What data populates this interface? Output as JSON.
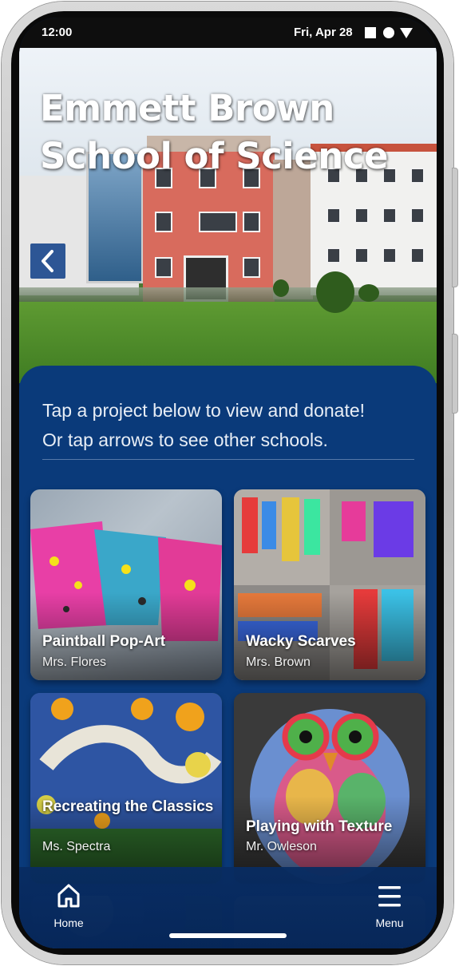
{
  "status_bar": {
    "time": "12:00",
    "date": "Fri, Apr 28",
    "icons": [
      "square-icon",
      "circle-icon",
      "triangle-icon"
    ]
  },
  "hero": {
    "title_line1": "Emmett Brown",
    "title_line2": "School of Science",
    "prev_icon": "chevron-left-icon",
    "carousel": {
      "count": 2,
      "active_index": 2
    }
  },
  "intro": {
    "line1": "Tap a project below to view and donate!",
    "line2": "Or tap arrows to see other schools."
  },
  "projects": [
    {
      "title": "Paintball Pop-Art",
      "teacher": "Mrs. Flores"
    },
    {
      "title": "Wacky Scarves",
      "teacher": "Mrs. Brown"
    },
    {
      "title": "Recreating the Classics",
      "teacher": "Ms. Spectra"
    },
    {
      "title": "Playing with Texture",
      "teacher": "Mr. Owleson"
    }
  ],
  "nav": {
    "home_label": "Home",
    "menu_label": "Menu"
  },
  "colors": {
    "panel": "#0a3a7a",
    "nav": "#062f6e",
    "accent": "#184a8c"
  }
}
